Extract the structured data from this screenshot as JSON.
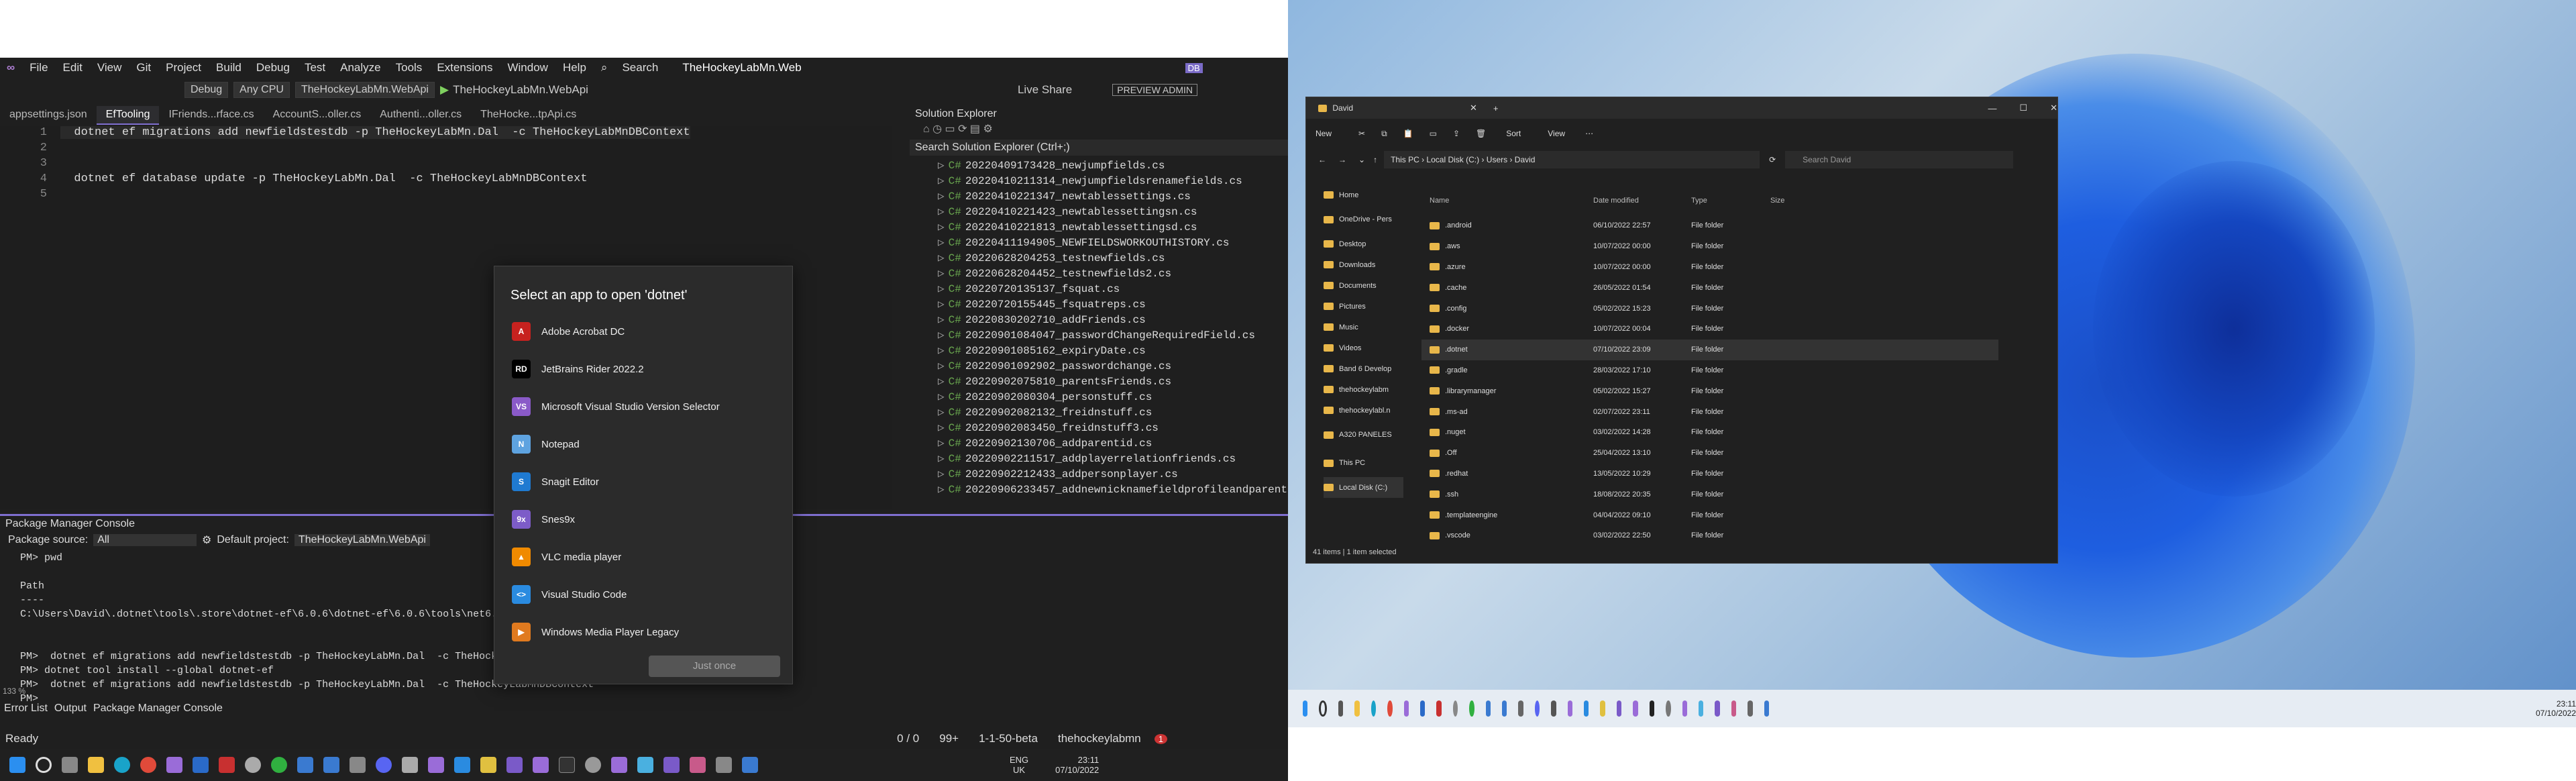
{
  "vs": {
    "menu": [
      "File",
      "Edit",
      "View",
      "Git",
      "Project",
      "Build",
      "Debug",
      "Test",
      "Analyze",
      "Tools",
      "Extensions",
      "Window",
      "Help"
    ],
    "search": "Search",
    "solution_title": "TheHockeyLabMn.Web",
    "user_initials": "DB",
    "toolbar": {
      "config": "Debug",
      "platform": "Any CPU",
      "startup": "TheHockeyLabMn.WebApi",
      "run": "TheHockeyLabMn.WebApi",
      "live_share": "Live Share",
      "preview": "PREVIEW ADMIN"
    },
    "tabs": [
      "appsettings.json",
      "EfTooling",
      "IFriends...rface.cs",
      "AccountS...oller.cs",
      "Authenti...oller.cs",
      "TheHocke...tpApi.cs"
    ],
    "editor_lines": [
      {
        "n": "1",
        "text": "  dotnet ef migrations add newfieldstestdb -p TheHockeyLabMn.Dal  -c TheHockeyLabMnDBContext"
      },
      {
        "n": "2",
        "text": ""
      },
      {
        "n": "3",
        "text": ""
      },
      {
        "n": "4",
        "text": "  dotnet ef database update -p TheHockeyLabMn.Dal  -c TheHockeyLabMnDBContext"
      },
      {
        "n": "5",
        "text": ""
      }
    ],
    "solution_explorer": {
      "title": "Solution Explorer",
      "search": "Search Solution Explorer (Ctrl+;)",
      "items": [
        "20220409173428_newjumpfields.cs",
        "20220410211314_newjumpfieldsrenamefields.cs",
        "20220410221347_newtablessettings.cs",
        "20220410221423_newtablessettingsn.cs",
        "20220410221813_newtablessettingsd.cs",
        "20220411194905_NEWFIELDSWORKOUTHISTORY.cs",
        "20220628204253_testnewfields.cs",
        "20220628204452_testnewfields2.cs",
        "20220720135137_fsquat.cs",
        "20220720155445_fsquatreps.cs",
        "20220830202710_addFriends.cs",
        "20220901084047_passwordChangeRequiredField.cs",
        "20220901085162_expiryDate.cs",
        "20220901092902_passwordchange.cs",
        "20220902075810_parentsFriends.cs",
        "20220902080304_personstuff.cs",
        "20220902082132_freidnstuff.cs",
        "20220902083450_freidnstuff3.cs",
        "20220902130706_addparentid.cs",
        "20220902211517_addplayerrelationfriends.cs",
        "20220902212433_addpersonplayer.cs",
        "20220906233457_addnewnicknamefieldprofileandparent"
      ]
    },
    "pmc": {
      "title": "Package Manager Console",
      "source_label": "Package source:",
      "source_value": "All",
      "project_label": "Default project:",
      "project_value": "TheHockeyLabMn.WebApi",
      "lines": [
        "PM> pwd",
        "",
        "Path",
        "----",
        "C:\\Users\\David\\.dotnet\\tools\\.store\\dotnet-ef\\6.0.6\\dotnet-ef\\6.0.6\\tools\\net6.0",
        "",
        "",
        "PM>  dotnet ef migrations add newfieldstestdb -p TheHockeyLabMn.Dal  -c TheHockeyLabMnDBContext",
        "PM> dotnet tool install --global dotnet-ef",
        "PM>  dotnet ef migrations add newfieldstestdb -p TheHockeyLabMn.Dal  -c TheHockeyLabMnDBContext",
        "PM>"
      ],
      "zoom": "133 %",
      "bottom_tabs": [
        "Error List",
        "Output",
        "Package Manager Console"
      ]
    },
    "status": {
      "ready": "Ready",
      "errors": "0 / 0",
      "lines": "99+",
      "branch": "1-1-50-beta",
      "repo": "thehockeylabmn",
      "notifications": "1"
    }
  },
  "dialog": {
    "title": "Select an app to open 'dotnet'",
    "apps": [
      {
        "name": "Adobe Acrobat DC",
        "color": "#c7221f",
        "glyph": "A"
      },
      {
        "name": "JetBrains Rider 2022.2",
        "color": "#000000",
        "glyph": "RD"
      },
      {
        "name": "Microsoft Visual Studio Version Selector",
        "color": "#8a5ac8",
        "glyph": "VS"
      },
      {
        "name": "Notepad",
        "color": "#5ea3e0",
        "glyph": "N"
      },
      {
        "name": "Snagit Editor",
        "color": "#1f7ad1",
        "glyph": "S"
      },
      {
        "name": "Snes9x",
        "color": "#7d5cc8",
        "glyph": "9x"
      },
      {
        "name": "VLC media player",
        "color": "#f08a00",
        "glyph": "▲"
      },
      {
        "name": "Visual Studio Code",
        "color": "#2a8be0",
        "glyph": "<>"
      },
      {
        "name": "Windows Media Player Legacy",
        "color": "#e07a1f",
        "glyph": "▶"
      }
    ],
    "button": "Just once"
  },
  "taskbar_left": {
    "lang": "ENG",
    "region": "UK",
    "time": "23:11",
    "date": "07/10/2022"
  },
  "explorer": {
    "title": "David",
    "toolbar": {
      "new": "New",
      "sort": "Sort",
      "view": "View"
    },
    "breadcrumb": [
      "This PC",
      "Local Disk (C:)",
      "Users",
      "David"
    ],
    "search": "Search David",
    "sidebar": [
      "Home",
      "OneDrive - Pers",
      "Desktop",
      "Downloads",
      "Documents",
      "Pictures",
      "Music",
      "Videos",
      "Band 6 Develop",
      "thehockeylabm",
      "thehockeylabl.n",
      "A320 PANELES",
      "This PC",
      "Local Disk (C:)"
    ],
    "columns": [
      "Name",
      "Date modified",
      "Type",
      "Size"
    ],
    "files": [
      {
        "name": ".android",
        "date": "06/10/2022 22:57",
        "type": "File folder"
      },
      {
        "name": ".aws",
        "date": "10/07/2022 00:00",
        "type": "File folder"
      },
      {
        "name": ".azure",
        "date": "10/07/2022 00:00",
        "type": "File folder"
      },
      {
        "name": ".cache",
        "date": "26/05/2022 01:54",
        "type": "File folder"
      },
      {
        "name": ".config",
        "date": "05/02/2022 15:23",
        "type": "File folder"
      },
      {
        "name": ".docker",
        "date": "10/07/2022 00:04",
        "type": "File folder"
      },
      {
        "name": ".dotnet",
        "date": "07/10/2022 23:09",
        "type": "File folder"
      },
      {
        "name": ".gradle",
        "date": "28/03/2022 17:10",
        "type": "File folder"
      },
      {
        "name": ".librarymanager",
        "date": "05/02/2022 15:27",
        "type": "File folder"
      },
      {
        "name": ".ms-ad",
        "date": "02/07/2022 23:11",
        "type": "File folder"
      },
      {
        "name": ".nuget",
        "date": "03/02/2022 14:28",
        "type": "File folder"
      },
      {
        "name": ".Off",
        "date": "25/04/2022 13:10",
        "type": "File folder"
      },
      {
        "name": ".redhat",
        "date": "13/05/2022 10:29",
        "type": "File folder"
      },
      {
        "name": ".ssh",
        "date": "18/08/2022 20:35",
        "type": "File folder"
      },
      {
        "name": ".templateengine",
        "date": "04/04/2022 09:10",
        "type": "File folder"
      },
      {
        "name": ".vscode",
        "date": "03/02/2022 22:50",
        "type": "File folder"
      }
    ],
    "status": "41 items",
    "selected": "1 item selected"
  },
  "taskbar_right": {
    "time": "23:11",
    "date": "07/10/2022"
  }
}
